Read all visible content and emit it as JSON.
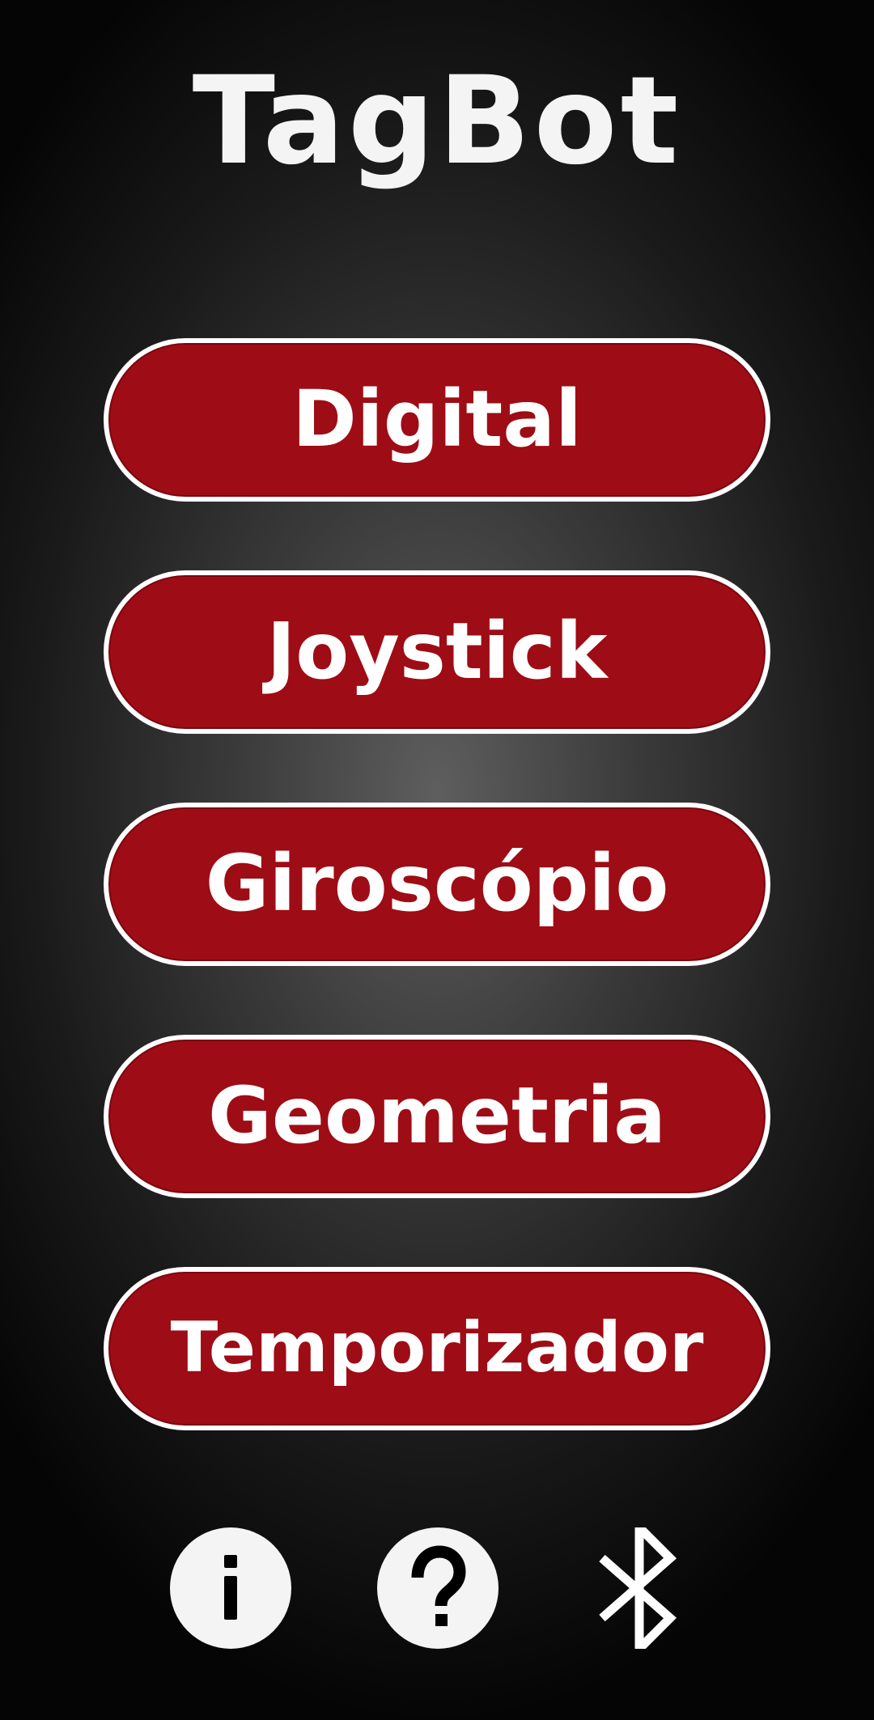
{
  "app": {
    "title": "TagBot"
  },
  "menu": {
    "items": [
      {
        "label": "Digital"
      },
      {
        "label": "Joystick"
      },
      {
        "label": "Giroscópio"
      },
      {
        "label": "Geometria"
      },
      {
        "label": "Temporizador"
      }
    ]
  },
  "bottom_bar": {
    "icons": [
      "info-icon",
      "help-icon",
      "bluetooth-icon"
    ]
  },
  "colors": {
    "button_fill": "#9e0c16",
    "button_border": "#ffffff",
    "text": "#f4f4f4",
    "background_center": "#5e5e5e",
    "background_edge": "#050505"
  }
}
